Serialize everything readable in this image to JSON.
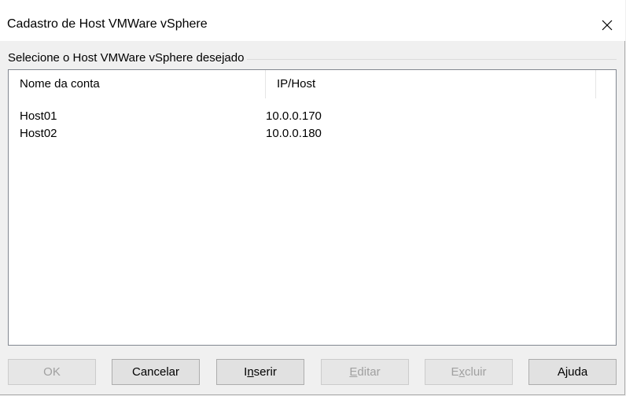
{
  "window": {
    "title": "Cadastro de Host VMWare vSphere"
  },
  "group": {
    "label": "Selecione o Host VMWare vSphere desejado"
  },
  "list": {
    "columns": [
      "Nome da conta",
      "IP/Host"
    ],
    "rows": [
      [
        "Host01",
        "10.0.0.170"
      ],
      [
        "Host02",
        "10.0.0.180"
      ]
    ]
  },
  "buttons": {
    "ok": {
      "label": "OK",
      "enabled": false
    },
    "cancelar": {
      "label": "Cancelar",
      "enabled": true
    },
    "inserir": {
      "label": "Inserir",
      "accesskey": "n",
      "enabled": true
    },
    "editar": {
      "label": "Editar",
      "accesskey": "E",
      "enabled": false
    },
    "excluir": {
      "label": "Excluir",
      "accesskey": "x",
      "enabled": false
    },
    "ajuda": {
      "label": "Ajuda",
      "enabled": true
    }
  }
}
